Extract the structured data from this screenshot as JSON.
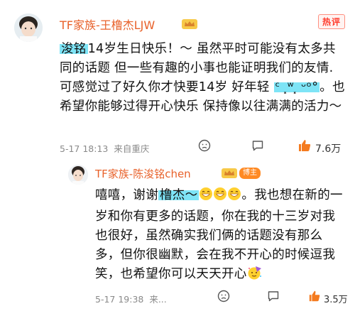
{
  "comment": {
    "author": "TF家族-王橹杰LJW",
    "hot_tag": "热评",
    "text_segments": [
      {
        "text": "浚铭",
        "highlight": true
      },
      {
        "text": "14岁生日快乐！～  虽然平时可能没有太多共同的话题 但一些有趣的小事也能证明我们的友情. 可感觉过了好久你才快要14岁  好年轻 ",
        "highlight": false
      },
      {
        "text": "ᶜ ⸼ʷ⸼ ᵕᵒ°",
        "highlight": true
      },
      {
        "text": "。也希望你能够过得开心快乐  保持像以往满满的活力～",
        "highlight": false
      }
    ],
    "date": "5-17 18:13",
    "location": "来自重庆",
    "likes": "7.6万"
  },
  "reply": {
    "author": "TF家族-陈浚铭chen",
    "author_tag": "博主",
    "text_before": "嘻嘻，谢谢",
    "highlight": "橹杰～",
    "text_after": "。我也想在新的一岁和你有更多的话题，你在我的十三岁对我也很好，虽然确实我们俩的话题没有那么多，但你很幽默，会在我不开心的时候逗我笑，也希望你可以天天开心",
    "date": "5-17 19:38",
    "location_truncated": "来...",
    "likes": "3.5万"
  },
  "icons": [
    "grinning-emoji-icon",
    "party-face-emoji-icon",
    "comment-icon",
    "reaction-icon",
    "thumbs-up-icon",
    "vip-crown-icon"
  ],
  "colors": {
    "author": "#e8612a",
    "highlight": "#7ee4f6",
    "hot_tag": "#ff3a2b",
    "like": "#f47b20",
    "meta": "#8a8a8a"
  }
}
